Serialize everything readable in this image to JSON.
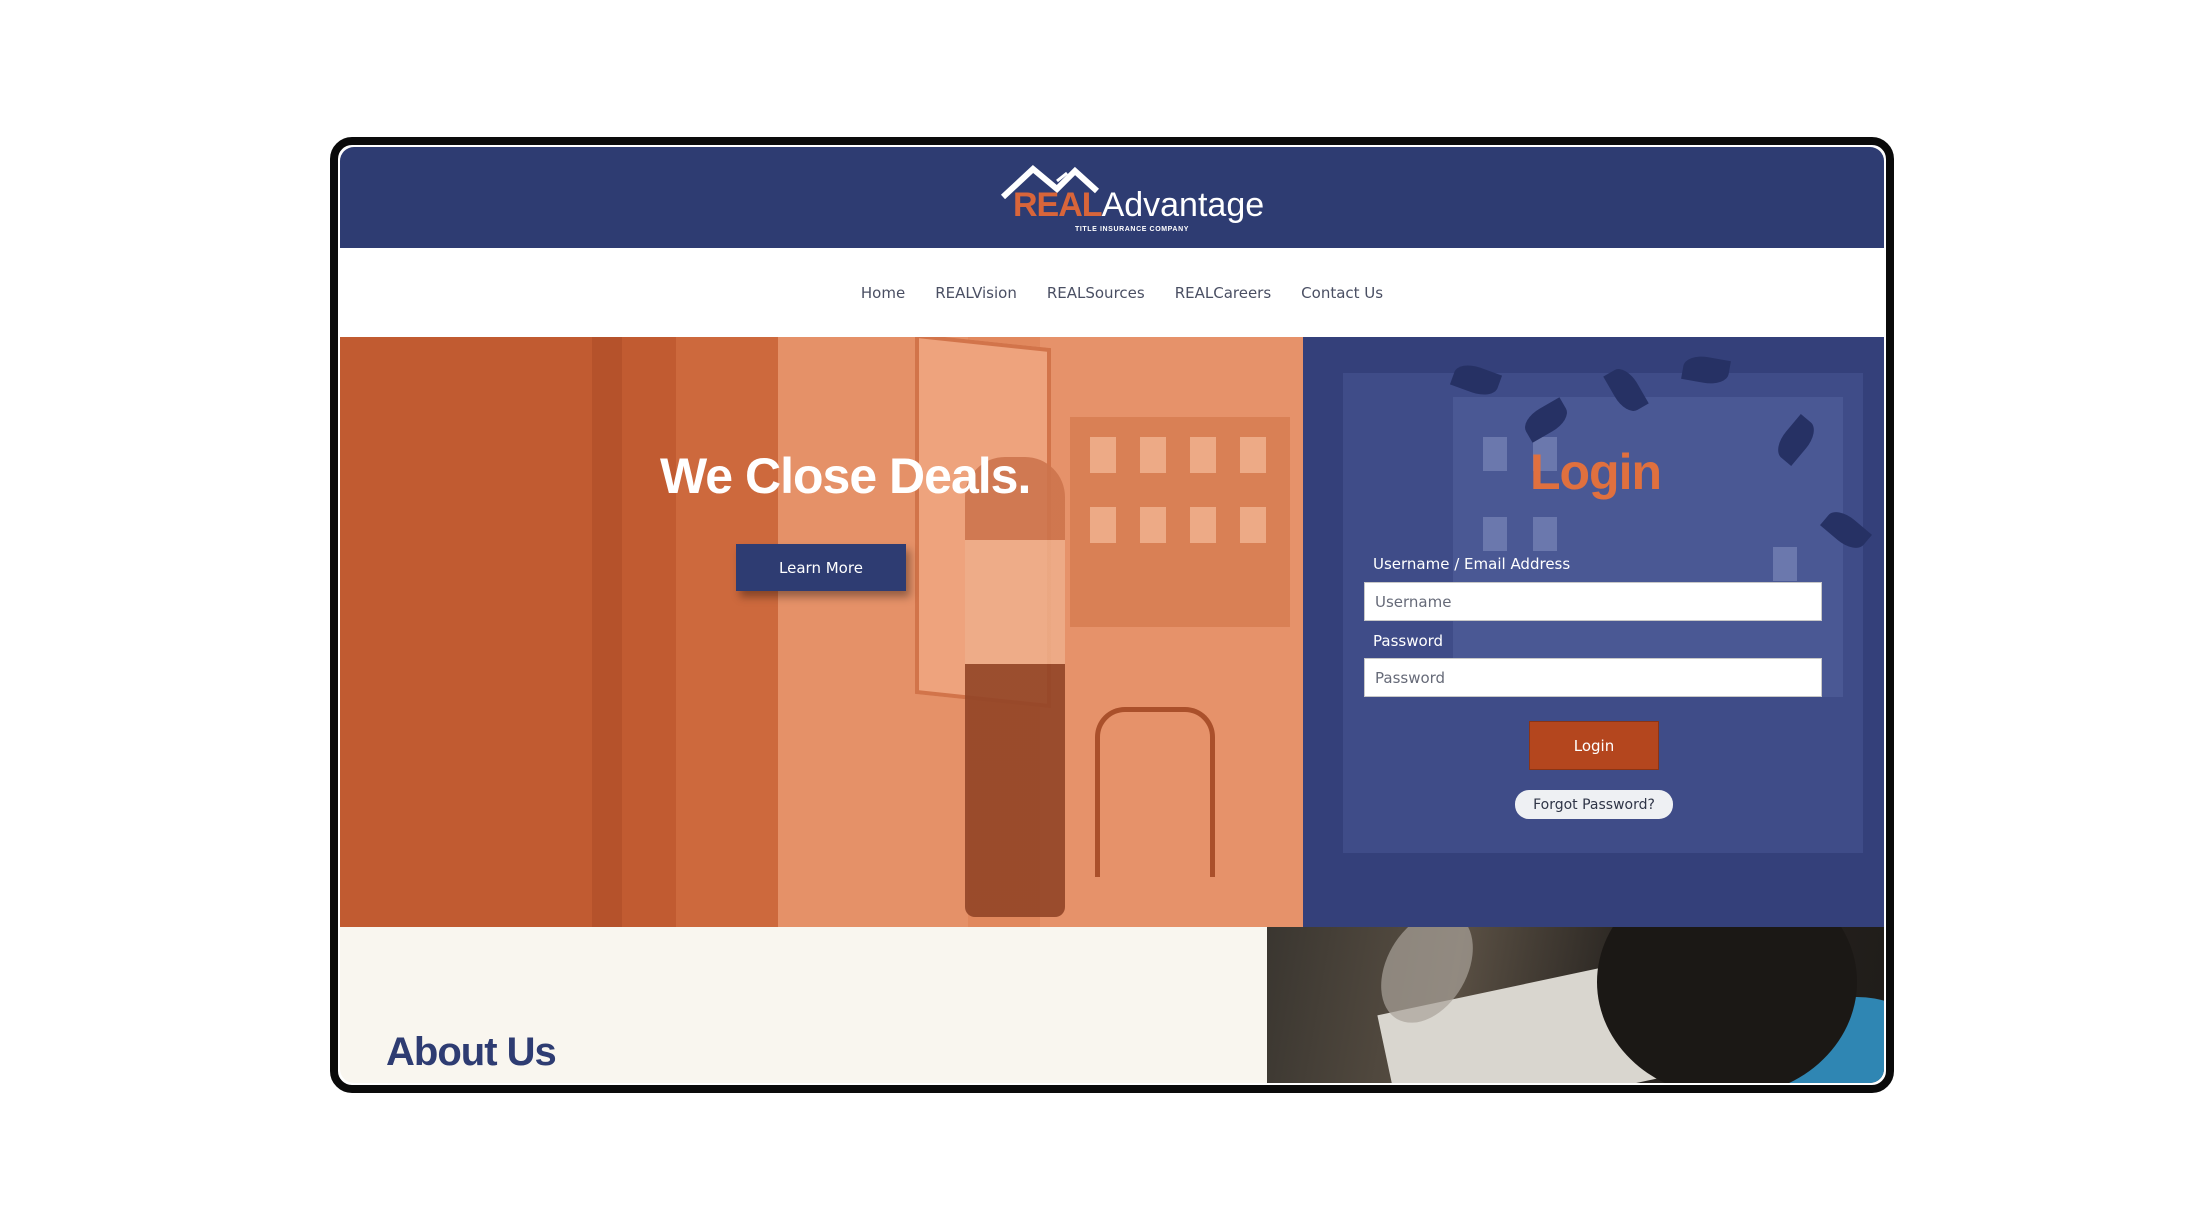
{
  "brand": {
    "logo_real": "REAL",
    "logo_advantage": "Advantage",
    "logo_subtitle": "TITLE INSURANCE COMPANY",
    "primary_color": "#2e3c72",
    "accent_color": "#d8653a"
  },
  "nav": {
    "items": [
      {
        "label": "Home"
      },
      {
        "label": "REALVision"
      },
      {
        "label": "REALSources"
      },
      {
        "label": "REALCareers"
      },
      {
        "label": "Contact Us"
      }
    ]
  },
  "hero": {
    "title": "We Close Deals.",
    "cta_label": "Learn More"
  },
  "login": {
    "title": "Login",
    "username_label": "Username / Email Address",
    "username_placeholder": "Username",
    "password_label": "Password",
    "password_placeholder": "Password",
    "submit_label": "Login",
    "forgot_label": "Forgot Password?"
  },
  "about": {
    "title": "About Us"
  }
}
